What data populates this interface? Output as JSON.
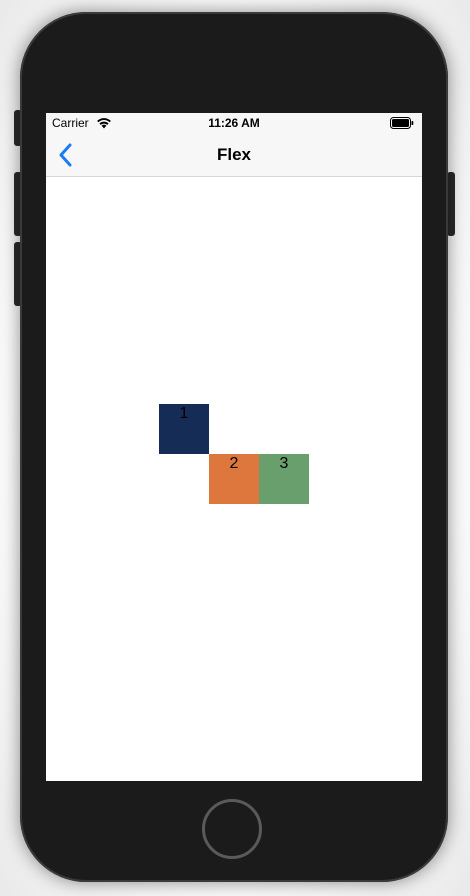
{
  "status_bar": {
    "carrier": "Carrier",
    "time": "11:26 AM",
    "wifi_icon": "wifi-icon",
    "battery_icon": "battery-full-icon"
  },
  "nav": {
    "title": "Flex",
    "back_icon": "chevron-left-icon",
    "accent": "#1a7cf5"
  },
  "boxes": [
    {
      "label": "1",
      "color": "#152c57"
    },
    {
      "label": "2",
      "color": "#de773d"
    },
    {
      "label": "3",
      "color": "#689f6c"
    }
  ],
  "device": {
    "home_button_icon": "home-button"
  }
}
